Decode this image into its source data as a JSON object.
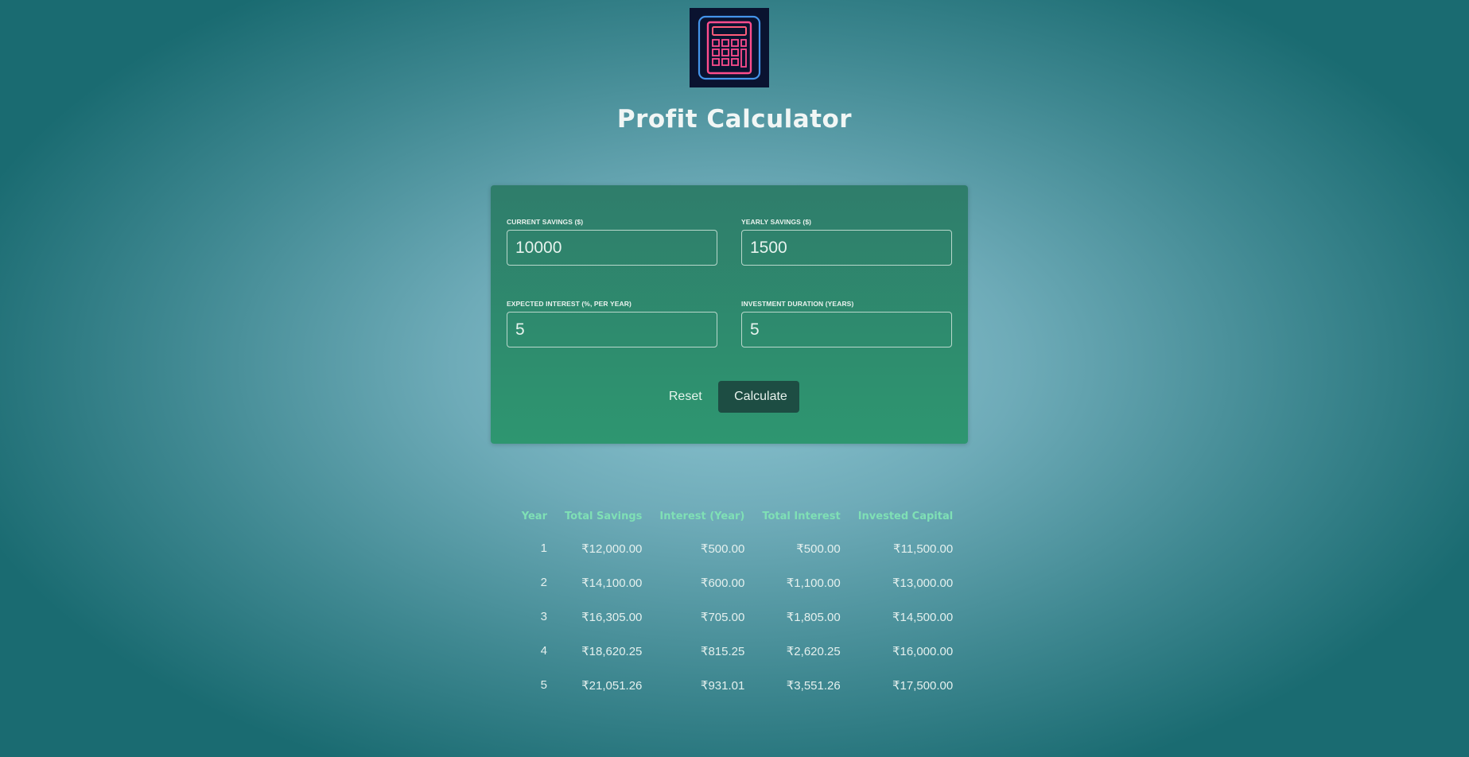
{
  "header": {
    "logo_icon": "calculator-icon",
    "title": "Profit Calculator"
  },
  "form": {
    "current_savings": {
      "label": "Current Savings ($)",
      "value": "10000"
    },
    "yearly_savings": {
      "label": "Yearly Savings ($)",
      "value": "1500"
    },
    "expected_interest": {
      "label": "Expected Interest (%, per year)",
      "value": "5"
    },
    "investment_duration": {
      "label": "Investment Duration (years)",
      "value": "5"
    },
    "reset_label": "Reset",
    "calculate_label": "Calculate"
  },
  "results": {
    "headers": [
      "Year",
      "Total Savings",
      "Interest (Year)",
      "Total Interest",
      "Invested Capital"
    ],
    "rows": [
      [
        "1",
        "₹12,000.00",
        "₹500.00",
        "₹500.00",
        "₹11,500.00"
      ],
      [
        "2",
        "₹14,100.00",
        "₹600.00",
        "₹1,100.00",
        "₹13,000.00"
      ],
      [
        "3",
        "₹16,305.00",
        "₹705.00",
        "₹1,805.00",
        "₹14,500.00"
      ],
      [
        "4",
        "₹18,620.25",
        "₹815.25",
        "₹2,620.25",
        "₹16,000.00"
      ],
      [
        "5",
        "₹21,051.26",
        "₹931.01",
        "₹3,551.26",
        "₹17,500.00"
      ]
    ]
  },
  "colors": {
    "card_top": "#2f7d6b",
    "card_bottom": "#2e9670",
    "header_text": "#7fe0b5",
    "calculate_button": "#1d4d43"
  }
}
